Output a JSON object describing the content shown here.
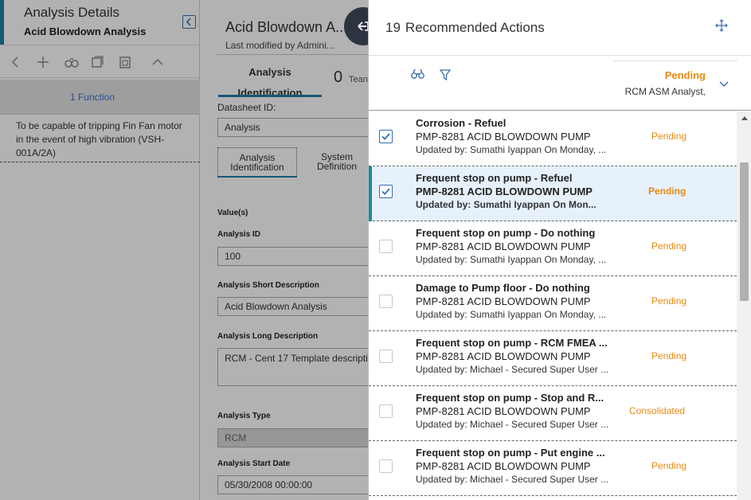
{
  "left_panel": {
    "title": "Analysis Details",
    "subtitle": "Acid Blowdown Analysis",
    "function_tab": "1 Function",
    "function_desc": "To be capable of tripping Fin Fan motor in the event of high vibration (VSH-001A/2A)"
  },
  "analysis": {
    "title": "Acid Blowdown A...",
    "modified": "Last modified by Admini...",
    "tab_label": "Analysis Identification",
    "team_count": "0",
    "team_label": "Tean",
    "datasheet_label": "Datasheet ID:",
    "datasheet_value": "Analysis",
    "subtab_1": "Analysis Identification",
    "subtab_2": "System Definition",
    "values_label": "Value(s)",
    "fields": {
      "id_label": "Analysis ID",
      "id_value": "100",
      "short_label": "Analysis Short Description",
      "short_value": "Acid Blowdown Analysis",
      "long_label": "Analysis Long Description",
      "long_value": "RCM - Cent 17 Template descripti",
      "type_label": "Analysis Type",
      "type_value": "RCM",
      "start_label": "Analysis Start Date",
      "start_value": "05/30/2008 00:00:00"
    }
  },
  "drawer": {
    "count": "19",
    "title": "Recommended Actions",
    "filter_status": "Pending",
    "filter_role": "RCM ASM Analyst,"
  },
  "rows": [
    {
      "title": "Corrosion - Refuel",
      "asset": "PMP-8281 ACID BLOWDOWN PUMP",
      "updated": "Updated by: Sumathi Iyappan On  Monday, ...",
      "status": "Pending",
      "checked": true
    },
    {
      "title": "Frequent stop on pump - Refuel",
      "asset": "PMP-8281 ACID BLOWDOWN PUMP",
      "updated": "Updated by: Sumathi Iyappan On  Mon...",
      "status": "Pending",
      "checked": true
    },
    {
      "title": "Frequent stop on pump - Do nothing",
      "asset": "PMP-8281 ACID BLOWDOWN PUMP",
      "updated": "Updated by: Sumathi Iyappan On  Monday, ...",
      "status": "Pending",
      "checked": false
    },
    {
      "title": "Damage to Pump floor - Do nothing",
      "asset": "PMP-8281 ACID BLOWDOWN PUMP",
      "updated": "Updated by: Sumathi Iyappan On  Monday, ...",
      "status": "Pending",
      "checked": false
    },
    {
      "title": "Frequent stop on pump - RCM FMEA ...",
      "asset": "PMP-8281 ACID BLOWDOWN PUMP",
      "updated": "Updated by: Michael - Secured Super User ...",
      "status": "Pending",
      "checked": false
    },
    {
      "title": "Frequent stop on pump - Stop and R...",
      "asset": "PMP-8281 ACID BLOWDOWN PUMP",
      "updated": "Updated by: Michael - Secured Super User ...",
      "status": "Consolidated",
      "checked": false
    },
    {
      "title": "Frequent stop on pump - Put engine ...",
      "asset": "PMP-8281 ACID BLOWDOWN PUMP",
      "updated": "Updated by: Michael - Secured Super User ...",
      "status": "Pending",
      "checked": false
    }
  ],
  "colors": {
    "status_orange": "#e88a12",
    "accent_teal": "#1a8aa0",
    "checkbox_blue": "#2f6fb5",
    "selected_row_bg": "#e6f1fb"
  }
}
